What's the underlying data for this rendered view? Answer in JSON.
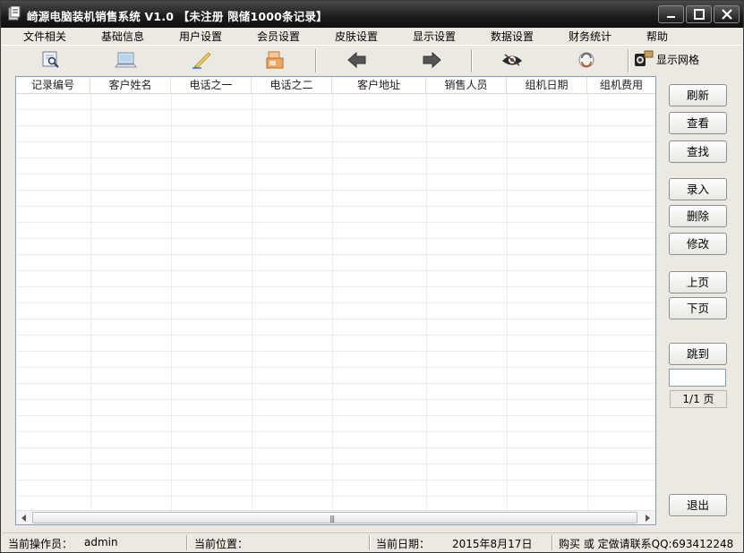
{
  "window": {
    "title": "崎源电脑装机销售系统 V1.0 【未注册 限储1000条记录】"
  },
  "menu": [
    {
      "label": "文件相关"
    },
    {
      "label": "基础信息"
    },
    {
      "label": "用户设置"
    },
    {
      "label": "会员设置"
    },
    {
      "label": "皮肤设置"
    },
    {
      "label": "显示设置"
    },
    {
      "label": "数据设置"
    },
    {
      "label": "财务统计"
    },
    {
      "label": "帮助"
    }
  ],
  "toolbar": {
    "icons": [
      "search-doc-icon",
      "monitor-icon",
      "pen-icon",
      "package-icon",
      "arrow-left-icon",
      "arrow-right-icon",
      "eye-icon",
      "refresh-icon",
      "grid-toggle-icon"
    ],
    "grid_toggle_label": "显示网格"
  },
  "table": {
    "columns": [
      "记录编号",
      "客户姓名",
      "电话之一",
      "电话之二",
      "客户地址",
      "销售人员",
      "组机日期",
      "组机费用"
    ],
    "rows": []
  },
  "side_buttons": {
    "refresh": "刷新",
    "view": "查看",
    "find": "查找",
    "add": "录入",
    "delete": "删除",
    "edit": "修改",
    "prev_page": "上页",
    "next_page": "下页",
    "jump": "跳到",
    "page_input_value": "",
    "page_indicator": "1/1 页",
    "exit": "退出"
  },
  "status": {
    "operator_label": "当前操作员：",
    "operator_value": "admin",
    "location_label": "当前位置：",
    "location_value": "",
    "date_label": "当前日期：",
    "date_value": "2015年8月17日",
    "contact": "购买 或 定做请联系QQ:693412248"
  },
  "colors": {
    "title_bar": "#1b1b1b",
    "window_bg": "#ece9e2",
    "grid_border": "#7f9db9"
  }
}
